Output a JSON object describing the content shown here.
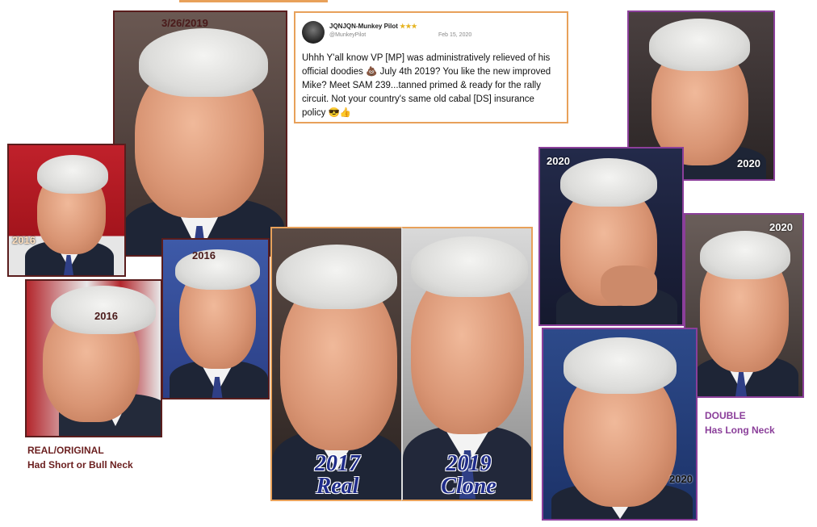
{
  "tweet": {
    "name": "JQNJQN-Munkey Pilot",
    "stars": "★★★",
    "handle": "@MunkeyPilot",
    "date": "Feb 15, 2020",
    "text": "Uhhh Y'all know VP [MP] was administratively relieved of his official doodies 💩 July 4th 2019?  You like the new improved Mike? Meet SAM 239...tanned primed & ready for the rally circuit. Not your country's same old cabal [DS] insurance policy 😎👍"
  },
  "labels": {
    "top_center": "3/26/2019",
    "left_red": "2016",
    "left_bottom": "2016",
    "mid_small": "2016",
    "right_top": "2020",
    "right_mid_hand": "2020",
    "right_mid_side": "2020",
    "right_bottom": "2020"
  },
  "captions": {
    "left_year": "2017",
    "left_word": "Real",
    "right_year": "2019",
    "right_word": "Clone"
  },
  "notes": {
    "real_line1": "REAL/ORIGINAL",
    "real_line2": "Had Short or Bull Neck",
    "double_line1": "DOUBLE",
    "double_line2": "Has Long Neck"
  },
  "colors": {
    "real_note": "#6b1f1f",
    "double_note": "#8b3f9a",
    "caption_text": "#1f2c8a",
    "tweet_border": "#e8a15a"
  }
}
